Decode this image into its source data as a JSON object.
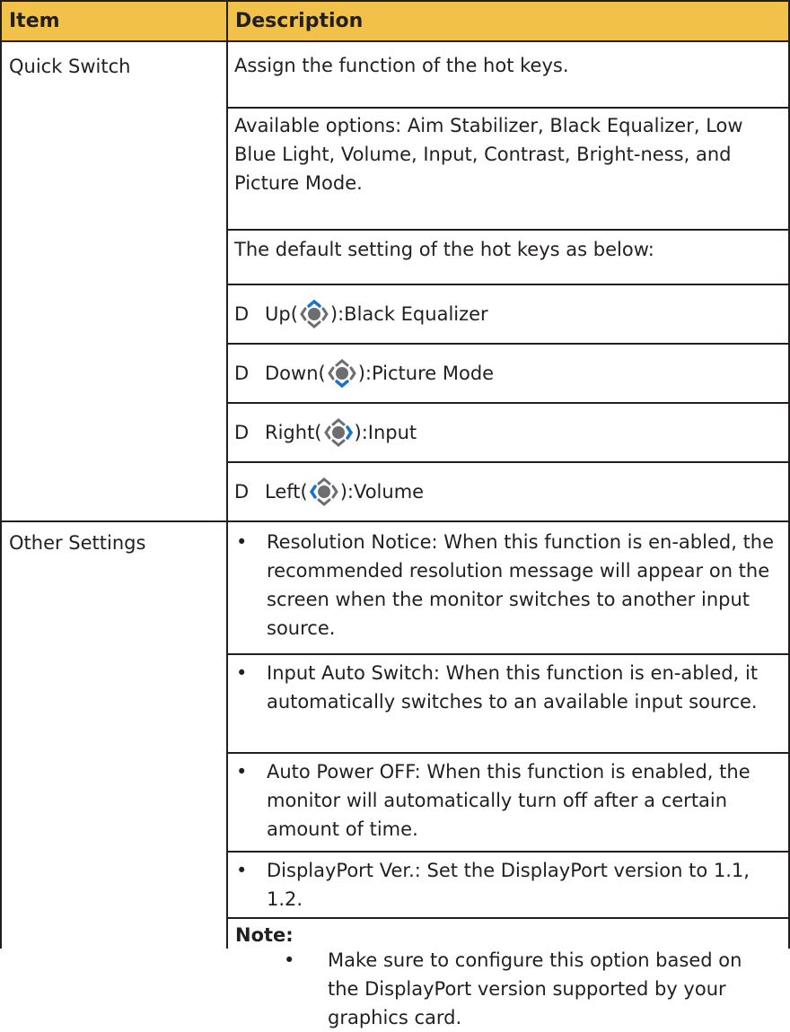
{
  "header": {
    "col_item": "Item",
    "col_description": "Description"
  },
  "quick_switch": {
    "item": "Quick Switch",
    "line1": "Assign the function of the hot keys.",
    "line2": "Available options: Aim Stabilizer, Black Equalizer, Low Blue Light, Volume, Input, Contrast, Bright-ness, and Picture Mode.",
    "line3": "The default setting of the hot keys as below:",
    "hotkeys": [
      {
        "marker": "D",
        "dir": "Up(",
        "after": "):Black Equalizer",
        "icon": "joystick-up-icon"
      },
      {
        "marker": "D",
        "dir": "Down(",
        "after": "):Picture Mode",
        "icon": "joystick-down-icon"
      },
      {
        "marker": "D",
        "dir": "Right(",
        "after": "):Input",
        "icon": "joystick-right-icon"
      },
      {
        "marker": "D",
        "dir": "Left(",
        "after": "):Volume",
        "icon": "joystick-left-icon"
      }
    ]
  },
  "other_settings": {
    "item": "Other Settings",
    "bullet": "•",
    "bullets": [
      "Resolution Notice: When this function is en-abled, the recommended resolution message will appear on the screen when the monitor switches to another input source.",
      "Input Auto Switch: When this function is en-abled, it automatically switches to an available input source.",
      "Auto Power OFF: When this function is enabled, the monitor will automatically turn off after a certain amount of time.",
      "DisplayPort Ver.: Set the DisplayPort version to 1.1, 1.2."
    ],
    "note_label": "Note:",
    "note_text": "Make sure to configure this option based on the DisplayPort version supported by your graphics card."
  },
  "colors": {
    "header_bg": "#f2c14a",
    "icon_blue": "#1a73c8",
    "icon_gray": "#6d6e71",
    "rule": "#231f20"
  }
}
